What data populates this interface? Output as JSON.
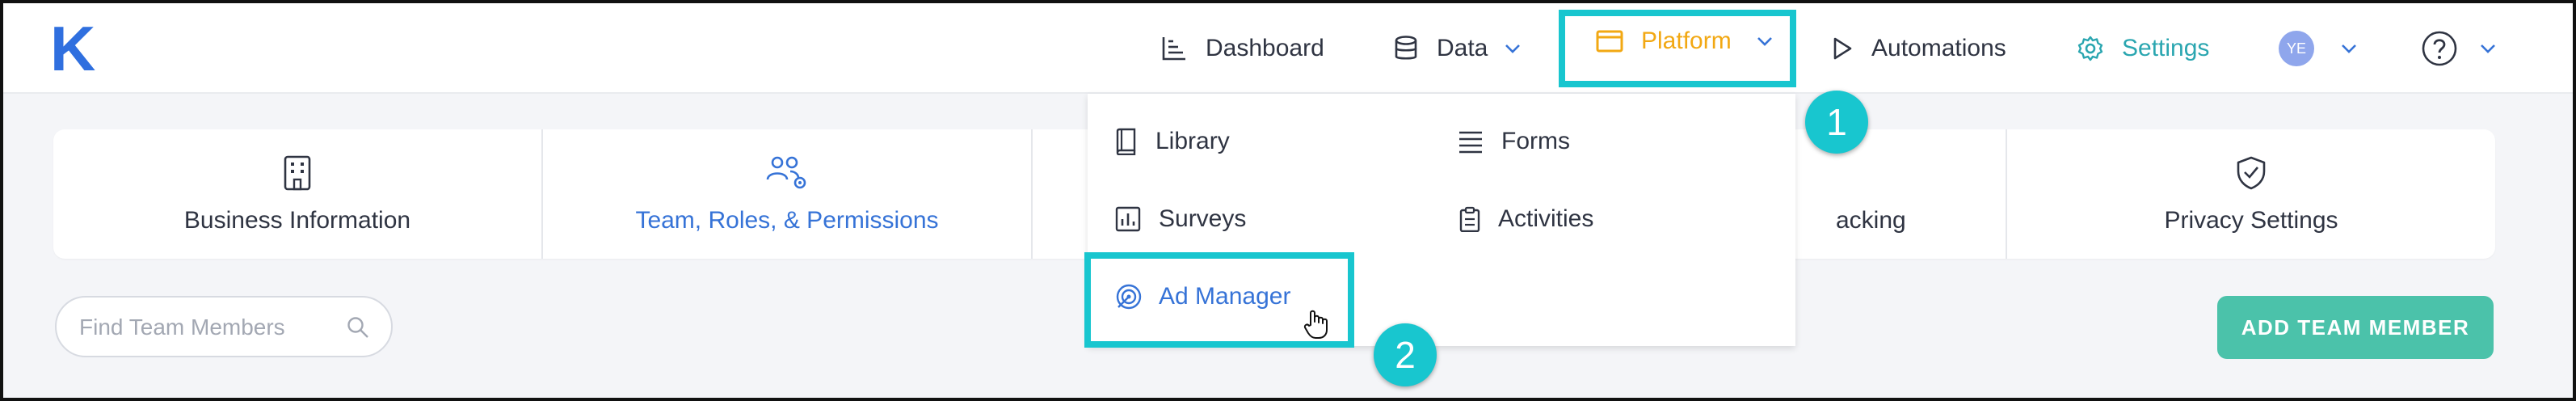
{
  "app": {
    "logo_text": "K"
  },
  "nav": {
    "dashboard": "Dashboard",
    "data": "Data",
    "platform": "Platform",
    "automations": "Automations",
    "settings": "Settings",
    "user_initials": "YE"
  },
  "tabs": [
    {
      "label": "Business Information",
      "icon": "building-icon",
      "active": false
    },
    {
      "label": "Team, Roles, & Permissions",
      "icon": "team-settings-icon",
      "active": true
    },
    {
      "label": "",
      "icon": "",
      "active": false
    },
    {
      "label": "acking",
      "icon": "",
      "active": false
    },
    {
      "label": "Privacy Settings",
      "icon": "shield-check-icon",
      "active": false
    }
  ],
  "search": {
    "placeholder": "Find Team Members",
    "value": ""
  },
  "actions": {
    "add_member": "ADD TEAM MEMBER"
  },
  "platform_menu": {
    "items": [
      {
        "label": "Library",
        "icon": "book-icon"
      },
      {
        "label": "Forms",
        "icon": "lines-icon"
      },
      {
        "label": "Surveys",
        "icon": "bar-chart-icon"
      },
      {
        "label": "Activities",
        "icon": "clipboard-icon"
      },
      {
        "label": "Ad Manager",
        "icon": "ad-target-icon",
        "highlighted": true
      }
    ]
  },
  "callouts": {
    "step1": "1",
    "step2": "2"
  },
  "colors": {
    "accent_blue": "#3673d7",
    "platform_orange": "#f2a813",
    "settings_teal": "#2aa6b0",
    "highlight_cyan": "#18c6cf",
    "button_green": "#4bc2aa"
  }
}
